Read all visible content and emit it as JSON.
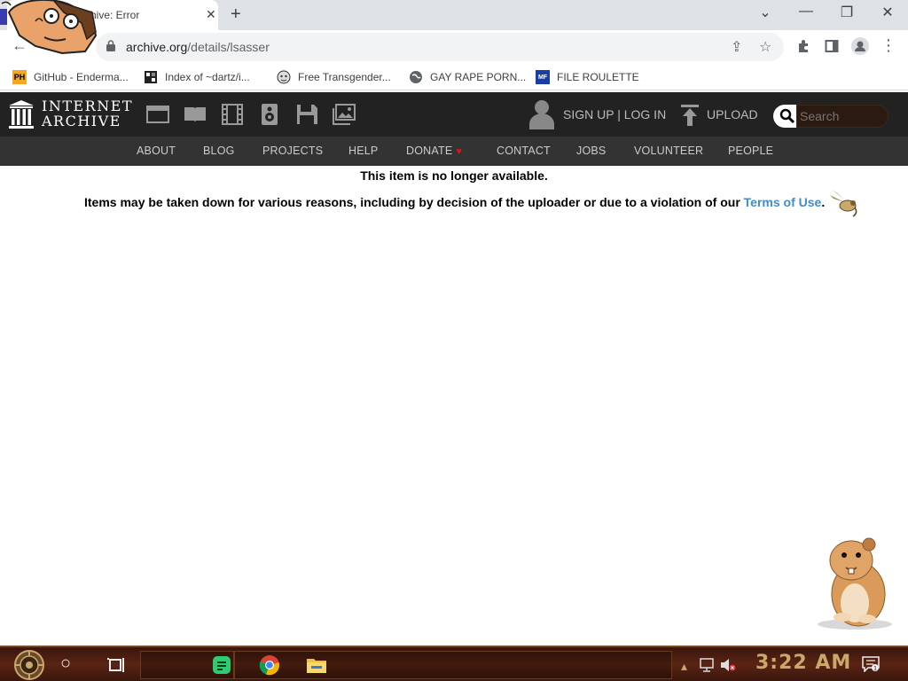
{
  "browser": {
    "tab_title": "chive: Error",
    "close_glyph": "✕",
    "new_tab_glyph": "+",
    "url_host": "archive.org",
    "url_path": "/details/lsasser",
    "window_controls": {
      "tab_search": "⌄",
      "minimize": "—",
      "restore": "❐",
      "close": "✕"
    },
    "bookmarks": [
      {
        "label": "GitHub - Enderma...",
        "icon": "PH-icon",
        "icon_text": "PH"
      },
      {
        "label": "Index of ~dartz/i...",
        "icon": "folder-index-icon",
        "icon_text": ""
      },
      {
        "label": "Free Transgender...",
        "icon": "face-icon",
        "icon_text": ""
      },
      {
        "label": "GAY RAPE PORN...",
        "icon": "globe-icon",
        "icon_text": ""
      },
      {
        "label": "FILE ROULETTE",
        "icon": "MF-icon",
        "icon_text": "MF"
      }
    ]
  },
  "ia": {
    "logo_line1": "INTERNET",
    "logo_line2": "ARCHIVE",
    "signup_login": "SIGN UP | LOG IN",
    "upload": "UPLOAD",
    "search_placeholder": "Search",
    "nav": [
      "ABOUT",
      "BLOG",
      "PROJECTS",
      "HELP",
      "DONATE",
      "CONTACT",
      "JOBS",
      "VOLUNTEER",
      "PEOPLE"
    ],
    "donate_heart": "♥"
  },
  "content": {
    "title": "This item is no longer available.",
    "body_prefix": "Items may be taken down for various reasons, including by decision of the uploader or due to a violation of our ",
    "terms_link": "Terms of Use",
    "body_suffix": "."
  },
  "taskbar": {
    "clock": "3:22 AM"
  },
  "colors": {
    "ia_header": "#222222",
    "ia_nav": "#333333",
    "link": "#428bca",
    "taskbar": "#5a2414",
    "clock": "#c9a86a"
  }
}
